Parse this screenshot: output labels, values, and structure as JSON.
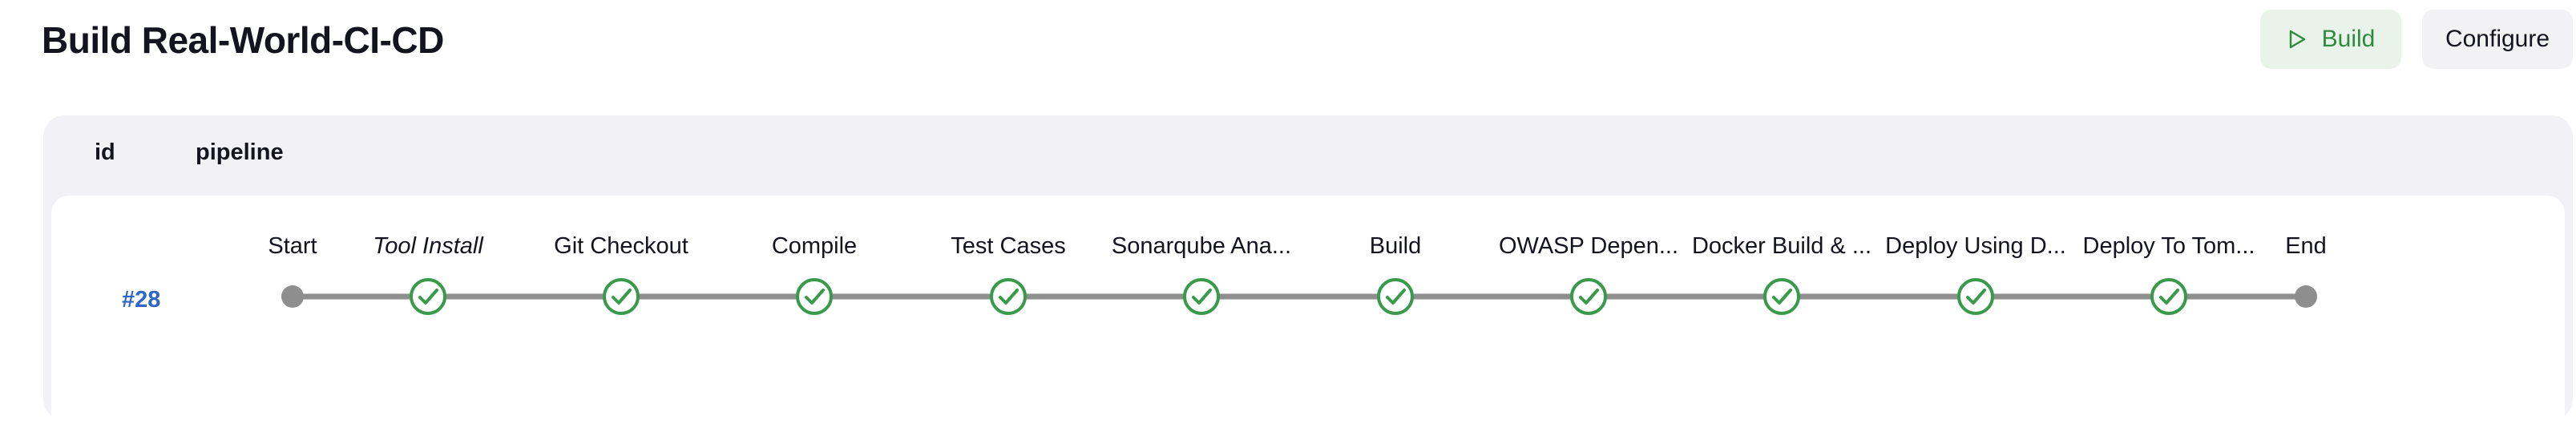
{
  "header": {
    "title": "Build Real-World-CI-CD",
    "build_label": "Build",
    "configure_label": "Configure"
  },
  "colors": {
    "success": "#3a9a4b",
    "track": "#8e8e8e",
    "node_grey": "#8e8e8e",
    "link": "#2f67c8",
    "build_bg": "#e9f3ea"
  },
  "table": {
    "columns": [
      "id",
      "pipeline"
    ],
    "rows": [
      {
        "id": "#28",
        "stages": [
          {
            "label": "Start",
            "status": "start",
            "italic": false
          },
          {
            "label": "Tool Install",
            "status": "success",
            "italic": true
          },
          {
            "label": "Git Checkout",
            "status": "success",
            "italic": false
          },
          {
            "label": "Compile",
            "status": "success",
            "italic": false
          },
          {
            "label": "Test Cases",
            "status": "success",
            "italic": false
          },
          {
            "label": "Sonarqube Ana...",
            "status": "success",
            "italic": false
          },
          {
            "label": "Build",
            "status": "success",
            "italic": false
          },
          {
            "label": "OWASP Depen...",
            "status": "success",
            "italic": false
          },
          {
            "label": "Docker Build & ...",
            "status": "success",
            "italic": false
          },
          {
            "label": "Deploy Using D...",
            "status": "success",
            "italic": false
          },
          {
            "label": "Deploy To Tom...",
            "status": "success",
            "italic": false
          },
          {
            "label": "End",
            "status": "end",
            "italic": false
          }
        ]
      }
    ]
  }
}
